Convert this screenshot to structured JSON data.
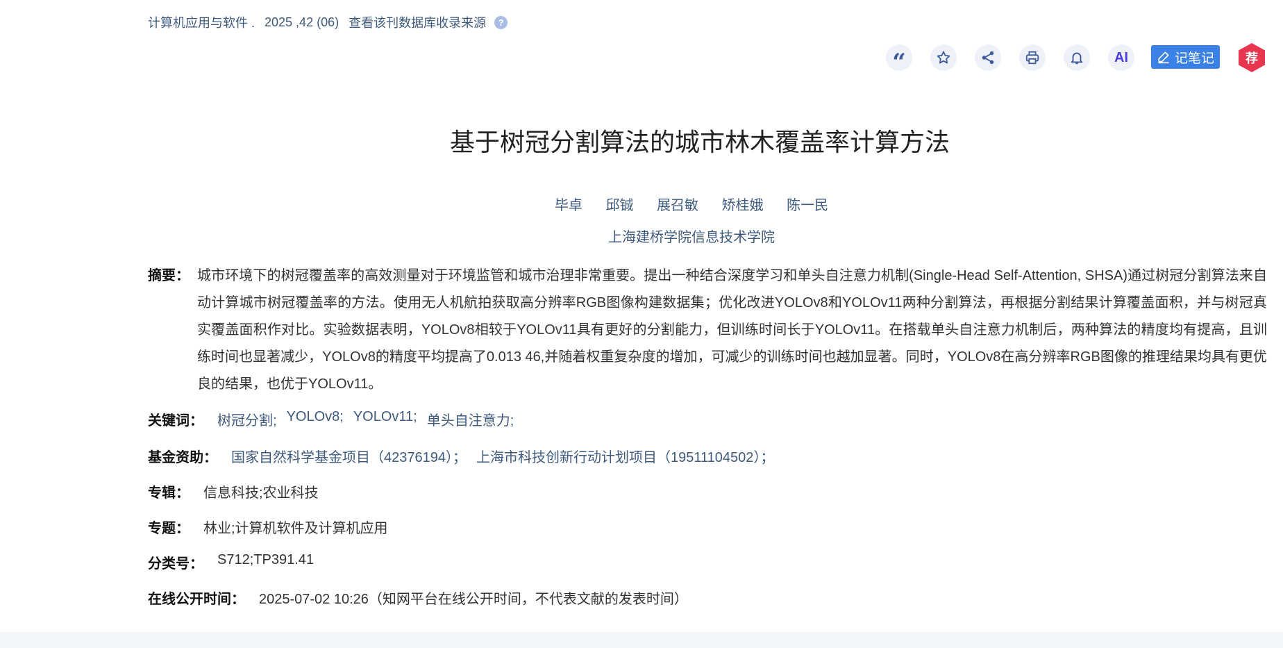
{
  "source": {
    "journal": "计算机应用与软件 .",
    "issue": "2025 ,42 (06)",
    "db_link": "查看该刊数据库收录来源",
    "help_glyph": "?"
  },
  "toolbar": {
    "quote_glyph": "“",
    "ai_label": "AI",
    "note_label": "记笔记",
    "recommend_label": "荐",
    "icons": [
      "quote-icon",
      "star-icon",
      "share-icon",
      "print-icon",
      "bell-icon",
      "ai-icon"
    ]
  },
  "article": {
    "title": "基于树冠分割算法的城市林木覆盖率计算方法",
    "authors": [
      "毕卓",
      "邱铖",
      "展召敏",
      "矫桂娥",
      "陈一民"
    ],
    "affiliation": "上海建桥学院信息技术学院",
    "abstract_label": "摘要：",
    "abstract": "城市环境下的树冠覆盖率的高效测量对于环境监管和城市治理非常重要。提出一种结合深度学习和单头自注意力机制(Single-Head Self-Attention, SHSA)通过树冠分割算法来自动计算城市树冠覆盖率的方法。使用无人机航拍获取高分辨率RGB图像构建数据集；优化改进YOLOv8和YOLOv11两种分割算法，再根据分割结果计算覆盖面积，并与树冠真实覆盖面积作对比。实验数据表明，YOLOv8相较于YOLOv11具有更好的分割能力，但训练时间长于YOLOv11。在搭载单头自注意力机制后，两种算法的精度均有提高，且训练时间也显著减少，YOLOv8的精度平均提高了0.013 46,并随着权重复杂度的增加，可减少的训练时间也越加显著。同时，YOLOv8在高分辨率RGB图像的推理结果均具有更优良的结果，也优于YOLOv11。",
    "keywords_label": "关键词：",
    "keywords": [
      "树冠分割;",
      "YOLOv8;",
      "YOLOv11;",
      "单头自注意力;"
    ],
    "funding_label": "基金资助：",
    "funding": [
      "国家自然科学基金项目（42376194）；",
      "上海市科技创新行动计划项目（19511104502）；"
    ],
    "series_label": "专辑：",
    "series": "信息科技;农业科技",
    "topic_label": "专题：",
    "topic": "林业;计算机软件及计算机应用",
    "class_label": "分类号：",
    "class_no": "S712;TP391.41",
    "online_label": "在线公开时间：",
    "online_time": "2025-07-02 10:26（知网平台在线公开时间，不代表文献的发表时间）"
  },
  "colors": {
    "link": "#3e5a7e",
    "accent_button": "#3c82e6",
    "recommend": "#e8364f",
    "ai": "#4b3ce0",
    "icon_bg": "#eef1f7"
  }
}
